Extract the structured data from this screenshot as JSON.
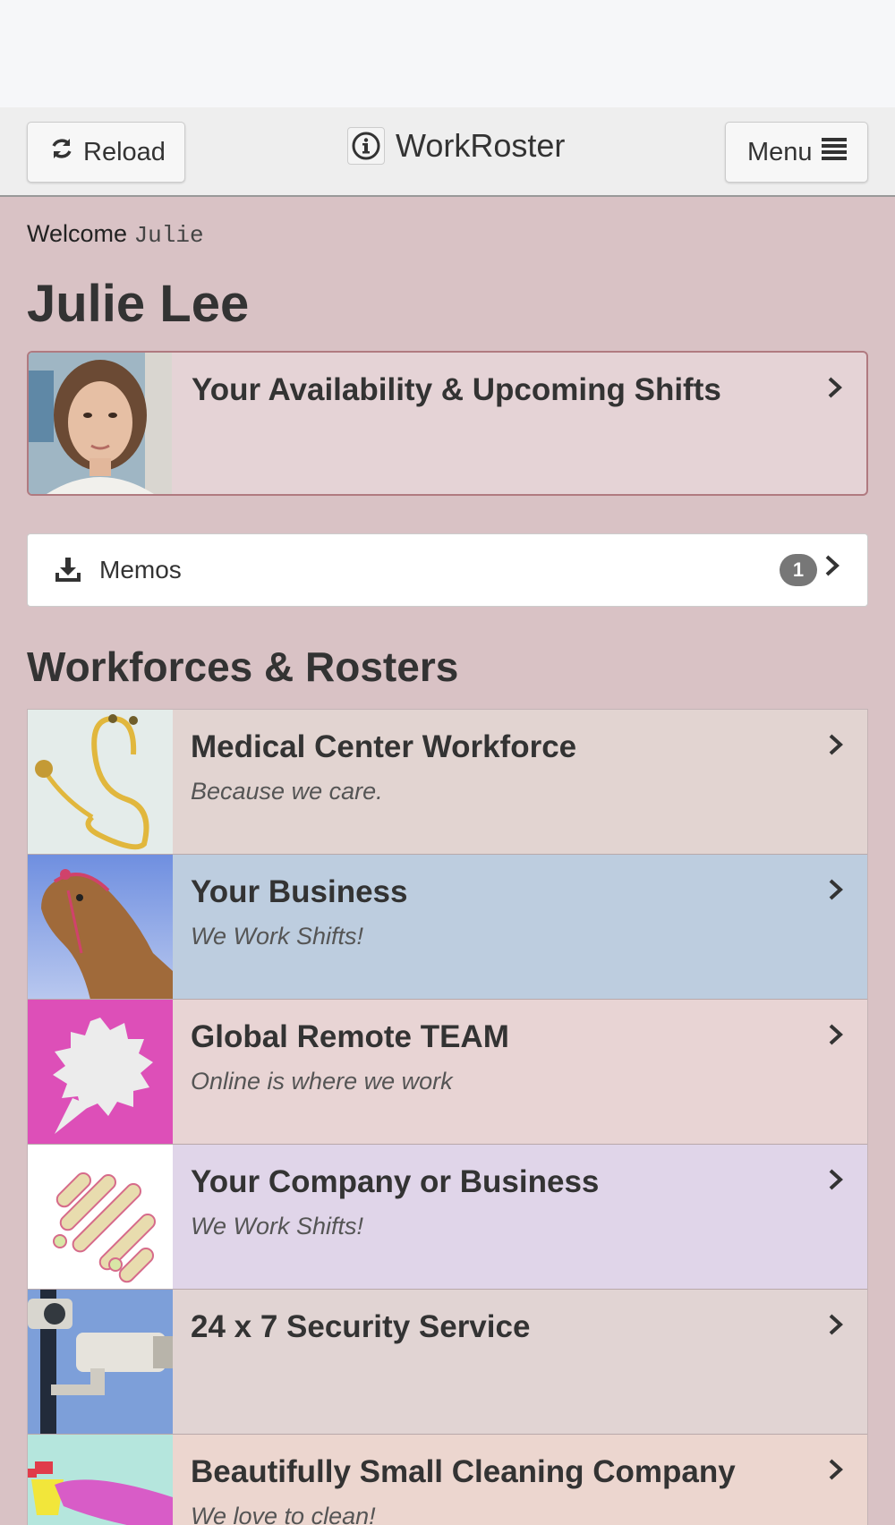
{
  "navbar": {
    "reload_label": "Reload",
    "brand": "WorkRoster",
    "menu_label": "Menu"
  },
  "welcome": {
    "prefix": "Welcome",
    "username": "Julie"
  },
  "page_title": "Julie Lee",
  "availability": {
    "title": "Your Availability & Upcoming Shifts"
  },
  "memos": {
    "label": "Memos",
    "count": "1"
  },
  "section_title": "Workforces & Rosters",
  "rosters": [
    {
      "title": "Medical Center Workforce",
      "subtitle": "Because we care.",
      "color": "#e2d4d1"
    },
    {
      "title": "Your Business",
      "subtitle": "We Work Shifts!",
      "color": "#bdcddf"
    },
    {
      "title": "Global Remote TEAM",
      "subtitle": "Online is where we work",
      "color": "#e8d4d4"
    },
    {
      "title": "Your Company or Business",
      "subtitle": "We Work Shifts!",
      "color": "#e0d5e9"
    },
    {
      "title": "24 x 7 Security Service",
      "subtitle": "",
      "color": "#e1d4d3"
    },
    {
      "title": "Beautifully Small Cleaning Company",
      "subtitle": "We love to clean!",
      "color": "#ecd6cf"
    }
  ],
  "colors": {
    "page_background": "#d9c2c5",
    "navbar_background": "#eeeeee",
    "badge": "#777777"
  }
}
